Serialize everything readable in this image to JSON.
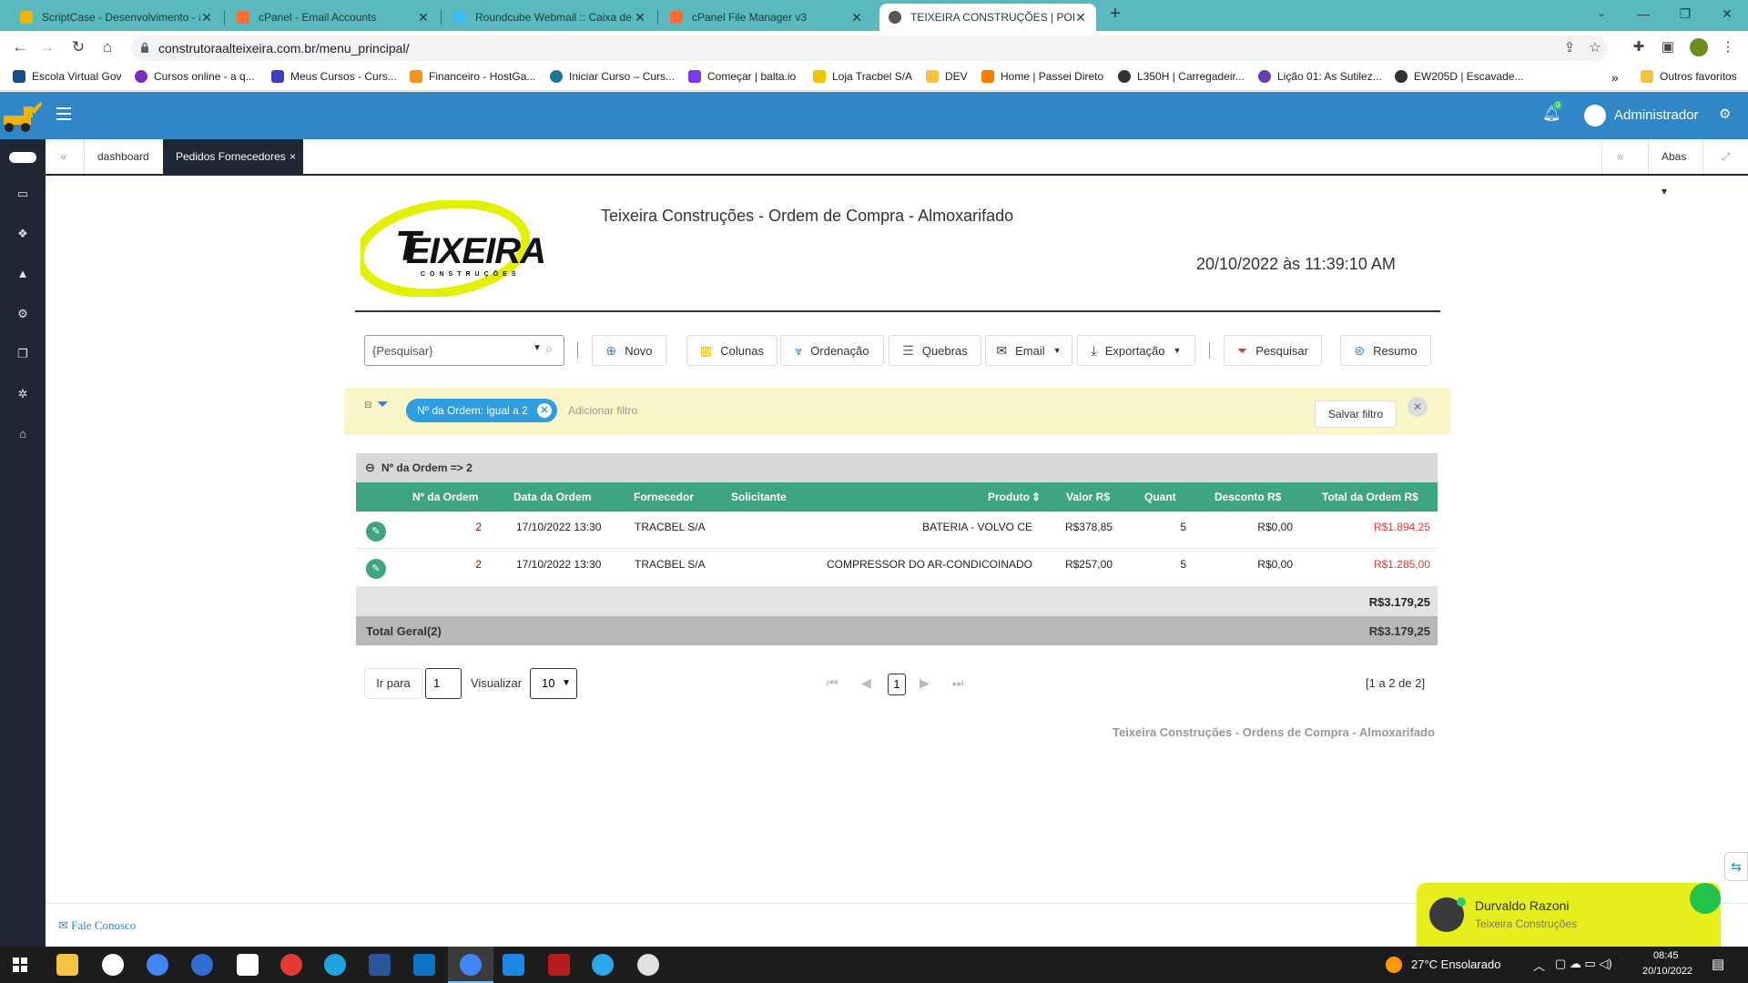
{
  "browser": {
    "tabs": [
      {
        "title": "ScriptCase - Desenvolvimento - a",
        "color": "#f0b400"
      },
      {
        "title": "cPanel - Email Accounts",
        "color": "#ff6c2c"
      },
      {
        "title": "Roundcube Webmail :: Caixa de e",
        "color": "#37beff"
      },
      {
        "title": "cPanel File Manager v3",
        "color": "#ff6c2c"
      },
      {
        "title": "TEIXEIRA CONSTRUÇÕES | PORTA",
        "color": "#555555"
      }
    ],
    "url": "construtoraalteixeira.com.br/menu_principal/",
    "bookmarks": [
      {
        "label": "Escola Virtual Gov",
        "color": "#1a4c8c"
      },
      {
        "label": "Cursos online - a q...",
        "color": "#7b2fbf"
      },
      {
        "label": "Meus Cursos - Curs...",
        "color": "#3f3fc2"
      },
      {
        "label": "Financeiro - HostGa...",
        "color": "#f7931e"
      },
      {
        "label": "Iniciar Curso – Curs...",
        "color": "#21759b"
      },
      {
        "label": "Começar | balta.io",
        "color": "#7c3aed"
      },
      {
        "label": "Loja Tracbel S/A",
        "color": "#f2c400"
      },
      {
        "label": "DEV",
        "color": "#f5c242"
      },
      {
        "label": "Home | Passei Direto",
        "color": "#ff7a00"
      },
      {
        "label": "L350H | Carregadeir...",
        "color": "#333333"
      },
      {
        "label": "Lição 01: As Sutilez...",
        "color": "#6a3fb5"
      },
      {
        "label": "EW205D | Escavade...",
        "color": "#333333"
      }
    ],
    "bookmarks_more": "»",
    "other_favorites": "Outros favoritos"
  },
  "app": {
    "admin_label": "Administrador",
    "notification_count": "0",
    "tabs": {
      "dashboard": "dashboard",
      "active": "Pedidos Fornecedores",
      "close": "×"
    },
    "abas_label": "Abas"
  },
  "report": {
    "title": "Teixeira Construções - Ordem de Compra - Almoxarifado",
    "datetime": "20/10/2022 às 11:39:10 AM",
    "logo_text": "EIXEIRA",
    "logo_sub": "CONSTRUÇÕES",
    "search_placeholder": "{Pesquisar}",
    "toolbar": {
      "novo": "Novo",
      "colunas": "Colunas",
      "ordenacao": "Ordenação",
      "quebras": "Quebras",
      "email": "Email",
      "exportacao": "Exportação",
      "pesquisar": "Pesquisar",
      "resumo": "Resumo"
    },
    "filter": {
      "chip": "Nº da Ordem: igual a 2",
      "add": "Adicionar filtro",
      "save": "Salvar filtro"
    },
    "group_label": "Nº da Ordem => 2",
    "columns": [
      "Nº da Ordem",
      "Data da Ordem",
      "Fornecedor",
      "Solicitante",
      "Produto",
      "Valor R$",
      "Quant",
      "Desconto R$",
      "Total da Ordem R$"
    ],
    "rows": [
      {
        "ordem": "2",
        "data": "17/10/2022 13:30",
        "fornecedor": "TRACBEL S/A",
        "solicitante": "",
        "produto": "BATERIA - VOLVO CE",
        "valor": "R$378,85",
        "quant": "5",
        "desconto": "R$0,00",
        "total": "R$1.894,25"
      },
      {
        "ordem": "2",
        "data": "17/10/2022 13:30",
        "fornecedor": "TRACBEL S/A",
        "solicitante": "",
        "produto": "COMPRESSOR DO AR-CONDICOINADO",
        "valor": "R$257,00",
        "quant": "5",
        "desconto": "R$0,00",
        "total": "R$1.285,00"
      }
    ],
    "subtotal": "R$3.179,25",
    "total_label": "Total Geral(2)",
    "total": "R$3.179,25",
    "pagination": {
      "goto_label": "Ir para",
      "goto_value": "1",
      "view_label": "Visualizar",
      "view_value": "10",
      "current_page": "1",
      "range": "[1 a 2 de 2]"
    },
    "footer_title": "Teixeira Construções - Ordens de Compra - Almoxarifado"
  },
  "footer": {
    "contact": "Fale Conosco"
  },
  "chat": {
    "name": "Durvaldo Razoni",
    "company": "Teixeira Construções"
  },
  "taskbar": {
    "weather": "27°C  Ensolarado",
    "time": "08:45",
    "date": "20/10/2022"
  }
}
